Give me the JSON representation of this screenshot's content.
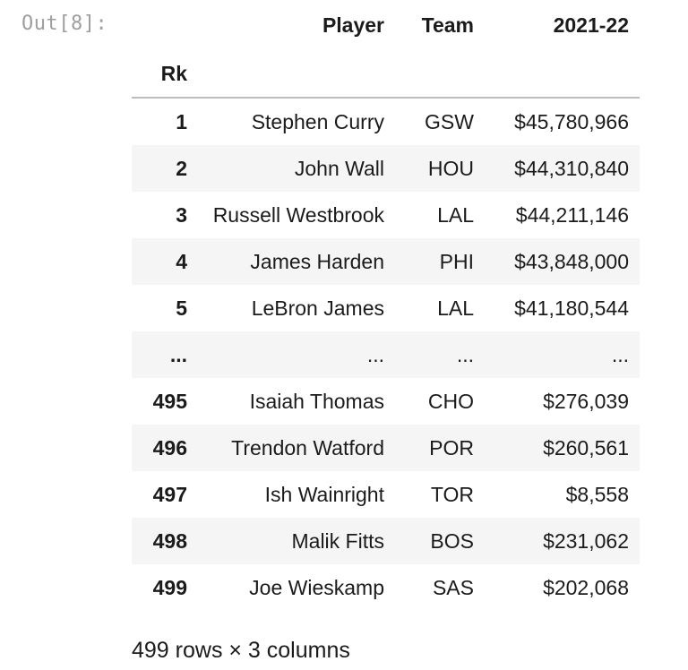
{
  "prompt": "Out[8]:",
  "table": {
    "columns": [
      "Player",
      "Team",
      "2021-22"
    ],
    "index_name": "Rk",
    "rows": [
      {
        "rk": "1",
        "player": "Stephen Curry",
        "team": "GSW",
        "salary": "$45,780,966"
      },
      {
        "rk": "2",
        "player": "John Wall",
        "team": "HOU",
        "salary": "$44,310,840"
      },
      {
        "rk": "3",
        "player": "Russell Westbrook",
        "team": "LAL",
        "salary": "$44,211,146"
      },
      {
        "rk": "4",
        "player": "James Harden",
        "team": "PHI",
        "salary": "$43,848,000"
      },
      {
        "rk": "5",
        "player": "LeBron James",
        "team": "LAL",
        "salary": "$41,180,544"
      },
      {
        "rk": "...",
        "player": "...",
        "team": "...",
        "salary": "..."
      },
      {
        "rk": "495",
        "player": "Isaiah Thomas",
        "team": "CHO",
        "salary": "$276,039"
      },
      {
        "rk": "496",
        "player": "Trendon Watford",
        "team": "POR",
        "salary": "$260,561"
      },
      {
        "rk": "497",
        "player": "Ish Wainright",
        "team": "TOR",
        "salary": "$8,558"
      },
      {
        "rk": "498",
        "player": "Malik Fitts",
        "team": "BOS",
        "salary": "$231,062"
      },
      {
        "rk": "499",
        "player": "Joe Wieskamp",
        "team": "SAS",
        "salary": "$202,068"
      }
    ]
  },
  "footer": "499 rows × 3 columns"
}
